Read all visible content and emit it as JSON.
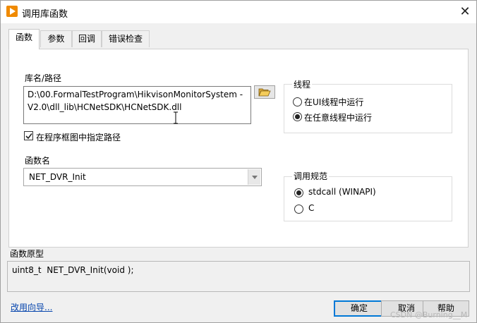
{
  "window": {
    "title": "调用库函数",
    "accent": "#f08a00"
  },
  "tabs": [
    {
      "label": "函数",
      "active": true
    },
    {
      "label": "参数",
      "active": false
    },
    {
      "label": "回调",
      "active": false
    },
    {
      "label": "错误检查",
      "active": false
    }
  ],
  "library": {
    "label": "库名/路径",
    "path_line1": "D:\\00.FormalTestProgram\\HikvisonMonitorSystem -",
    "path_line2": "V2.0\\dll_lib\\HCNetSDK\\HCNetSDK.dll",
    "browse_icon": "folder-open-icon",
    "specify_path_label": "在程序框图中指定路径",
    "specify_path_checked": true
  },
  "function": {
    "label": "函数名",
    "selected": "NET_DVR_Init"
  },
  "thread": {
    "title": "线程",
    "options": [
      {
        "label": "在UI线程中运行",
        "checked": false
      },
      {
        "label": "在任意线程中运行",
        "checked": true
      }
    ]
  },
  "calling_convention": {
    "title": "调用规范",
    "options": [
      {
        "label": "stdcall (WINAPI)",
        "checked": true
      },
      {
        "label": "C",
        "checked": false
      }
    ]
  },
  "prototype": {
    "label": "函数原型",
    "value": "uint8_t  NET_DVR_Init(void );"
  },
  "footer": {
    "wizard_link": "改用向导...",
    "ok_label": "确定",
    "cancel_label": "取消",
    "help_label": "帮助",
    "watermark": "CSDN @Burning__M"
  }
}
